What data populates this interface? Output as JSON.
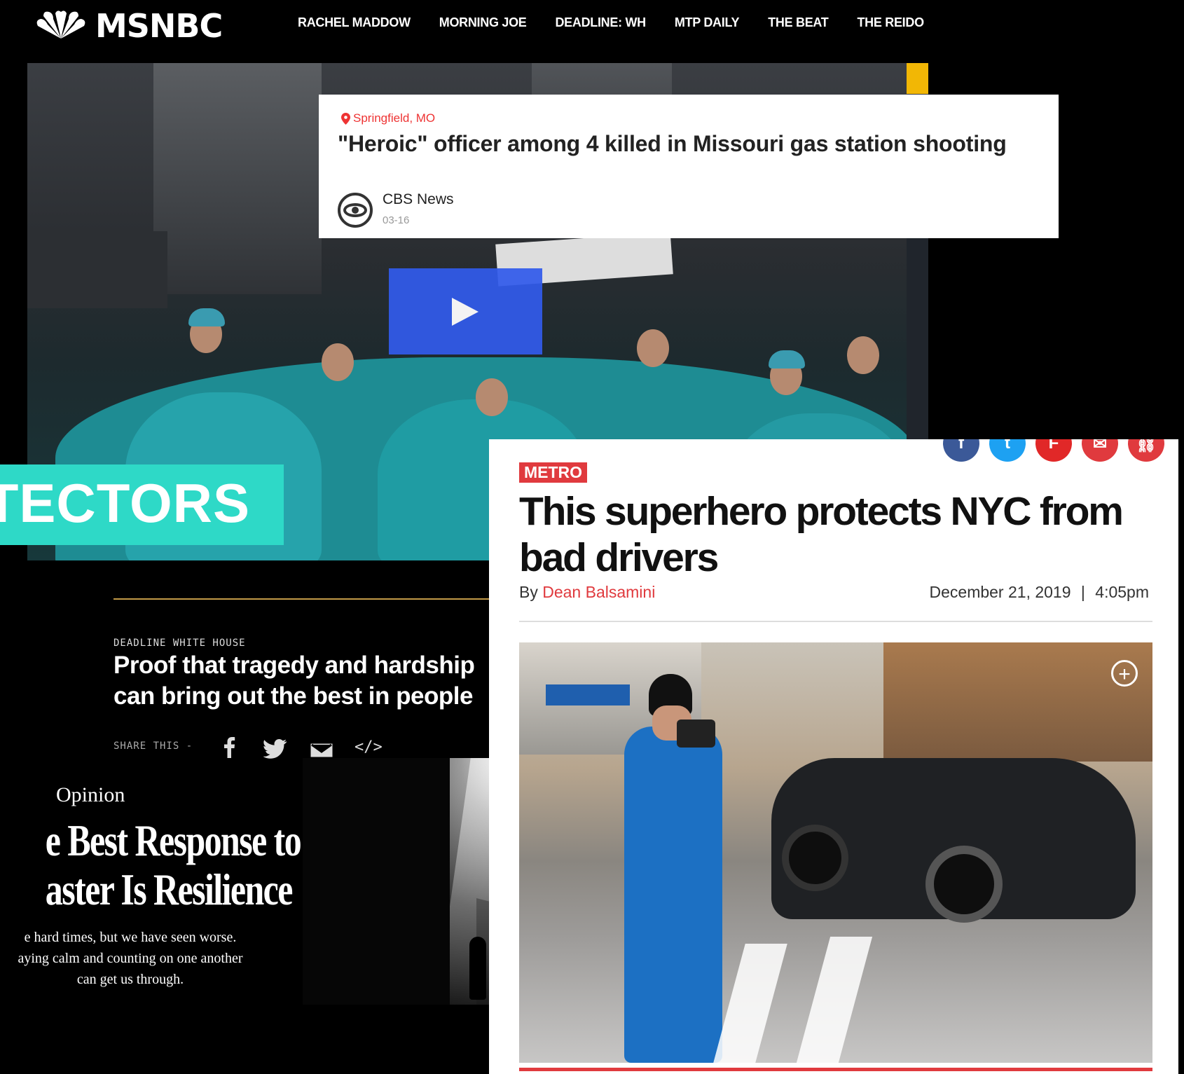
{
  "msnbc": {
    "logo_text": "MSNBC",
    "nav": [
      "RACHEL MADDOW",
      "MORNING JOE",
      "DEADLINE: WH",
      "MTP DAILY",
      "THE BEAT",
      "THE REIDO"
    ]
  },
  "cbs_card": {
    "location": "Springfield, MO",
    "headline": "\"Heroic\" officer among 4 killed in Missouri gas station shooting",
    "source": "CBS News",
    "date": "03-16"
  },
  "banner": {
    "text": "OTECTORS"
  },
  "deadline": {
    "kicker": "DEADLINE WHITE HOUSE",
    "title": "Proof that tragedy and hardship can bring out the best in people",
    "share_label": "SHARE THIS -"
  },
  "nyt": {
    "label": "Opinion",
    "title_line1": "e Best Response to",
    "title_line2": "aster Is Resilience",
    "summary_line1": "e hard times, but we have seen worse.",
    "summary_line2": "aying calm and counting on one another",
    "summary_line3": "can get us through."
  },
  "post": {
    "section": "METRO",
    "title": "This superhero protects NYC from bad drivers",
    "by_prefix": "By",
    "author": "Dean Balsamini",
    "date": "December 21, 2019",
    "separator": "|",
    "time": "4:05pm",
    "social_icons": [
      "facebook-icon",
      "twitter-icon",
      "flipboard-icon",
      "email-icon",
      "link-icon"
    ]
  },
  "colors": {
    "msnbc_play": "#3a5aeb",
    "banner_teal": "#2ed9c7",
    "post_red": "#e03a3e",
    "deadline_gold": "#c29a47"
  }
}
